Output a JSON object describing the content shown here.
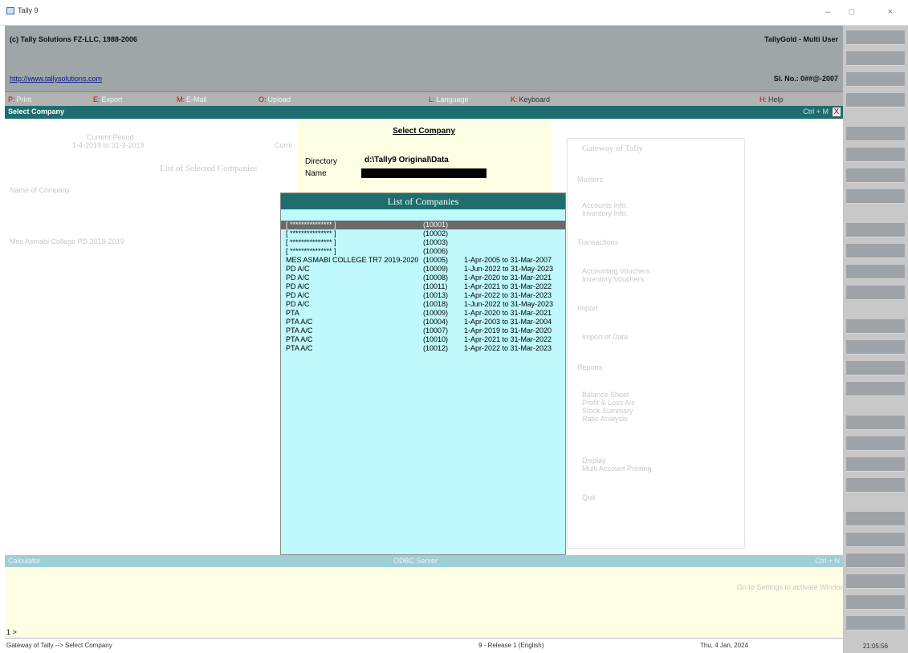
{
  "window": {
    "title": "Tally 9",
    "minimize": "–",
    "maximize": "□",
    "close": "×"
  },
  "header": {
    "copyright": "(c) Tally Solutions FZ-LLC, 1988-2006",
    "product": "TallyGold - Multi User",
    "url": "http://www.tallysolutions.com",
    "serial": "Sl. No.: 0##@-2007"
  },
  "fkeys": [
    {
      "key": "P:",
      "label": "Print"
    },
    {
      "key": "E:",
      "label": "Export"
    },
    {
      "key": "M:",
      "label": "E-Mail"
    },
    {
      "key": "O:",
      "label": "Upload"
    },
    {
      "key": "L:",
      "label": "Language"
    },
    {
      "key": "K:",
      "label": "Keyboard"
    },
    {
      "key": "H:",
      "label": "Help"
    }
  ],
  "select_bar": {
    "title": "Select Company",
    "shortcut": "Ctrl + M",
    "close": "X"
  },
  "background": {
    "period_title": "Current Period",
    "period_value": "1-4-2019 to 31-3-2019",
    "current_date_short": "Curre",
    "selected_companies_title": "List of Selected Companies",
    "name_of_company_header": "Name of Company",
    "company_entry": "Mes Asmabi College PD 2018-2019",
    "gateway_title": "Gateway of Tally",
    "gateway_items": [
      "Masters",
      "Accounts Info.",
      "Inventory Info.",
      "Transactions",
      "Accounting Vouchers",
      "Inventory Vouchers",
      "Import",
      "Import of Data",
      "Reports",
      "Balance Sheet",
      "Profit & Loss A/c",
      "Stock Summary",
      "Ratio Analysis",
      "Display",
      "Multi Account Printing",
      "Quit"
    ]
  },
  "select_company": {
    "title": "Select Company",
    "directory_label": "Directory",
    "directory_value": "d:\\Tally9 Original\\Data",
    "name_label": "Name"
  },
  "list": {
    "title": "List of Companies",
    "rows": [
      {
        "name": "[ *************** ]",
        "code": "(10001)",
        "period": ""
      },
      {
        "name": "[ *************** ]",
        "code": "(10002)",
        "period": ""
      },
      {
        "name": "[ *************** ]",
        "code": "(10003)",
        "period": ""
      },
      {
        "name": "[ *************** ]",
        "code": "(10006)",
        "period": ""
      },
      {
        "name": "MES ASMABI COLLEGE TR7 2019-2020",
        "code": "(10005)",
        "period": "1-Apr-2005 to 31-Mar-2007"
      },
      {
        "name": "PD A/C",
        "code": "(10009)",
        "period": "1-Jun-2022 to 31-May-2023"
      },
      {
        "name": "PD A/C",
        "code": "(10008)",
        "period": "1-Apr-2020 to 31-Mar-2021"
      },
      {
        "name": "PD A/C",
        "code": "(10011)",
        "period": "1-Apr-2021 to 31-Mar-2022"
      },
      {
        "name": "PD A/C",
        "code": "(10013)",
        "period": "1-Apr-2022 to 31-Mar-2023"
      },
      {
        "name": "PD A/C",
        "code": "(10018)",
        "period": "1-Jun-2022 to 31-May-2023"
      },
      {
        "name": "PTA",
        "code": "(10009)",
        "period": "1-Apr-2020 to 31-Mar-2021"
      },
      {
        "name": "PTA A/C",
        "code": "(10004)",
        "period": "1-Apr-2003 to 31-Mar-2004"
      },
      {
        "name": "PTA A/C",
        "code": "(10007)",
        "period": "1-Apr-2019 to 31-Mar-2020"
      },
      {
        "name": "PTA A/C",
        "code": "(10010)",
        "period": "1-Apr-2021 to 31-Mar-2022"
      },
      {
        "name": "PTA A/C",
        "code": "(10012)",
        "period": "1-Apr-2022 to 31-Mar-2023"
      }
    ]
  },
  "calculator": {
    "label": "Calculator",
    "odbc": "ODBC Server",
    "shortcut": "Ctrl + N",
    "watermark": "Go to Settings to activate Windows.",
    "prompt": "1  >"
  },
  "status": {
    "path": "Gateway of Tally --> Select Company",
    "release": "9 - Release 1 (English)",
    "date": "Thu, 4 Jan, 2024",
    "time": "21:05:56"
  },
  "colors": {
    "header_bg": "#9ea6a8",
    "teal_bar": "#1e6e6e",
    "list_bg": "#bff9fb",
    "panel_bg": "#fefee4",
    "selected_row": "#6a6a6a"
  }
}
